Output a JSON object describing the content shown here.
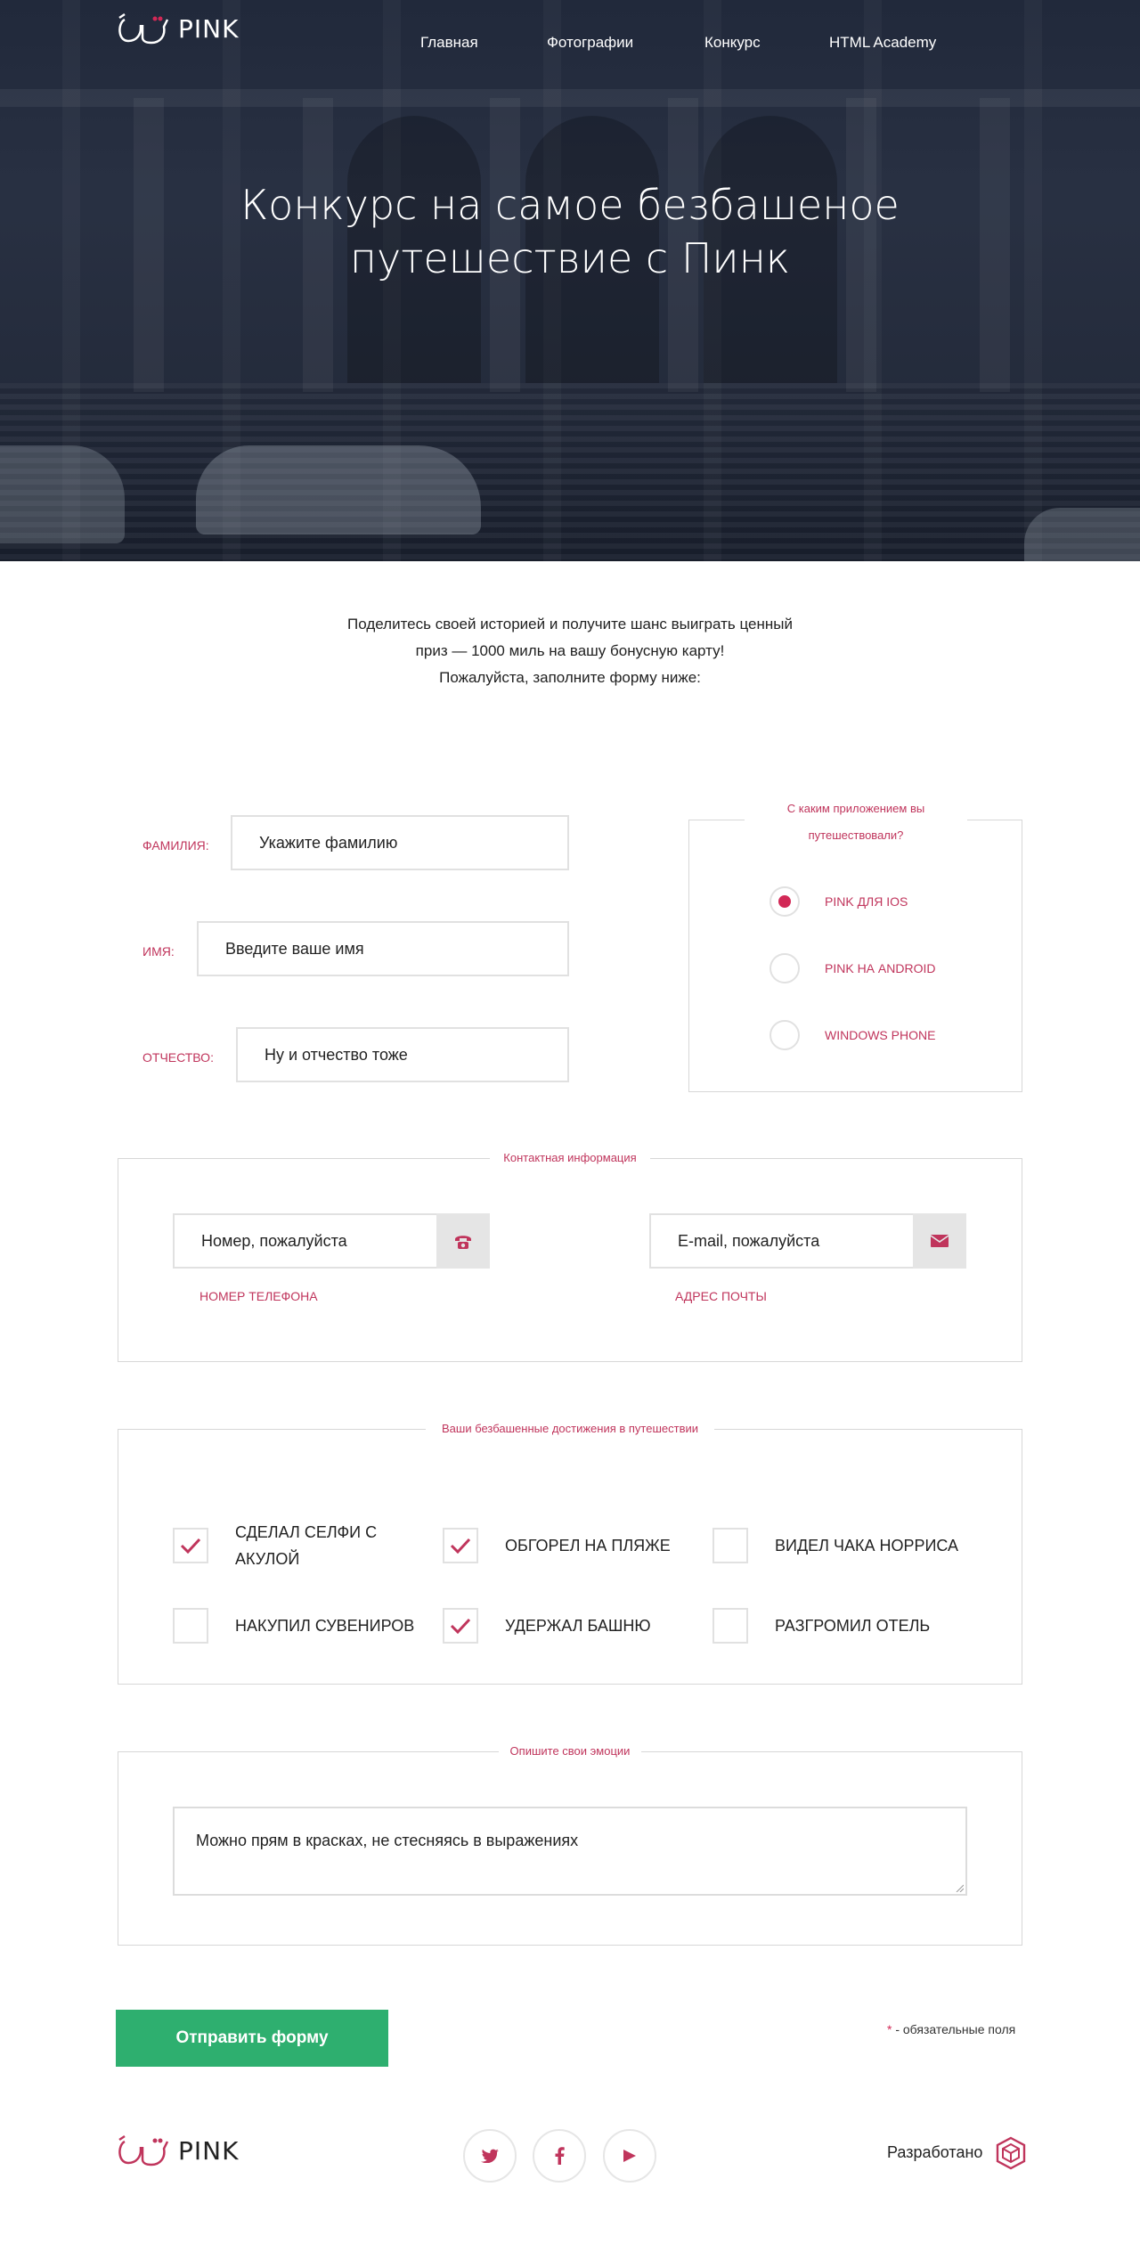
{
  "header": {
    "logo_text": "PINK",
    "nav": [
      {
        "label": "Главная"
      },
      {
        "label": "Фотографии"
      },
      {
        "label": "Конкурс"
      },
      {
        "label": "HTML Academy"
      }
    ]
  },
  "hero": {
    "title_line1": "Конкурс на самое безбашеное",
    "title_line2": "путешествие с Пинк"
  },
  "intro": {
    "line1": "Поделитесь своей историей и получите шанс выиграть ценный",
    "line2": "приз — 1000 миль на вашу бонусную карту!",
    "line3": "Пожалуйста, заполните форму ниже:"
  },
  "name_fields": [
    {
      "label": "ФАМИЛИЯ:",
      "placeholder": "Укажите фамилию"
    },
    {
      "label": "ИМЯ:",
      "placeholder": "Введите ваше имя"
    },
    {
      "label": "ОТЧЕСТВО:",
      "placeholder": "Ну и отчество тоже"
    }
  ],
  "app_choice": {
    "legend_line1": "С каким приложением вы",
    "legend_line2": "путешествовали?",
    "options": [
      {
        "label": "PINK ДЛЯ IOS",
        "checked": true
      },
      {
        "label": "PINK НА ANDROID",
        "checked": false
      },
      {
        "label": "WINDOWS PHONE",
        "checked": false
      }
    ]
  },
  "contact": {
    "legend": "Контактная информация",
    "phone_placeholder": "Номер, пожалуйста",
    "phone_label": "НОМЕР ТЕЛЕФОНА",
    "phone_icon": "phone-icon",
    "email_placeholder": "E-mail, пожалуйста",
    "email_label": "АДРЕС ПОЧТЫ",
    "email_icon": "mail-icon"
  },
  "achievements": {
    "legend": "Ваши безбашенные достижения в путешествии",
    "items": [
      {
        "line1": "СДЕЛАЛ СЕЛФИ С",
        "line2": "АКУЛОЙ",
        "checked": true
      },
      {
        "line1": "ОБГОРЕЛ НА ПЛЯЖЕ",
        "line2": "",
        "checked": true
      },
      {
        "line1": "ВИДЕЛ ЧАКА НОРРИСА",
        "line2": "",
        "checked": false
      },
      {
        "line1": "НАКУПИЛ СУВЕНИРОВ",
        "line2": "",
        "checked": false
      },
      {
        "line1": "УДЕРЖАЛ БАШНЮ",
        "line2": "",
        "checked": true
      },
      {
        "line1": "РАЗГРОМИЛ ОТЕЛЬ",
        "line2": "",
        "checked": false
      }
    ]
  },
  "emotions": {
    "legend": "Опишите свои эмоции",
    "placeholder": "Можно прям в красках, не стесняясь в выражениях"
  },
  "submit_label": "Отправить форму",
  "required_note": {
    "star": "*",
    "text": " - обязательные поля"
  },
  "footer": {
    "logo_text": "PINK",
    "social": [
      {
        "icon": "twitter-icon"
      },
      {
        "icon": "facebook-icon"
      },
      {
        "icon": "youtube-icon"
      }
    ],
    "developed_by": "Разработано"
  },
  "colors": {
    "accent": "#d22856",
    "label": "#c0355c",
    "submit": "#2eaf6f",
    "hero_overlay": "#2a3244"
  }
}
